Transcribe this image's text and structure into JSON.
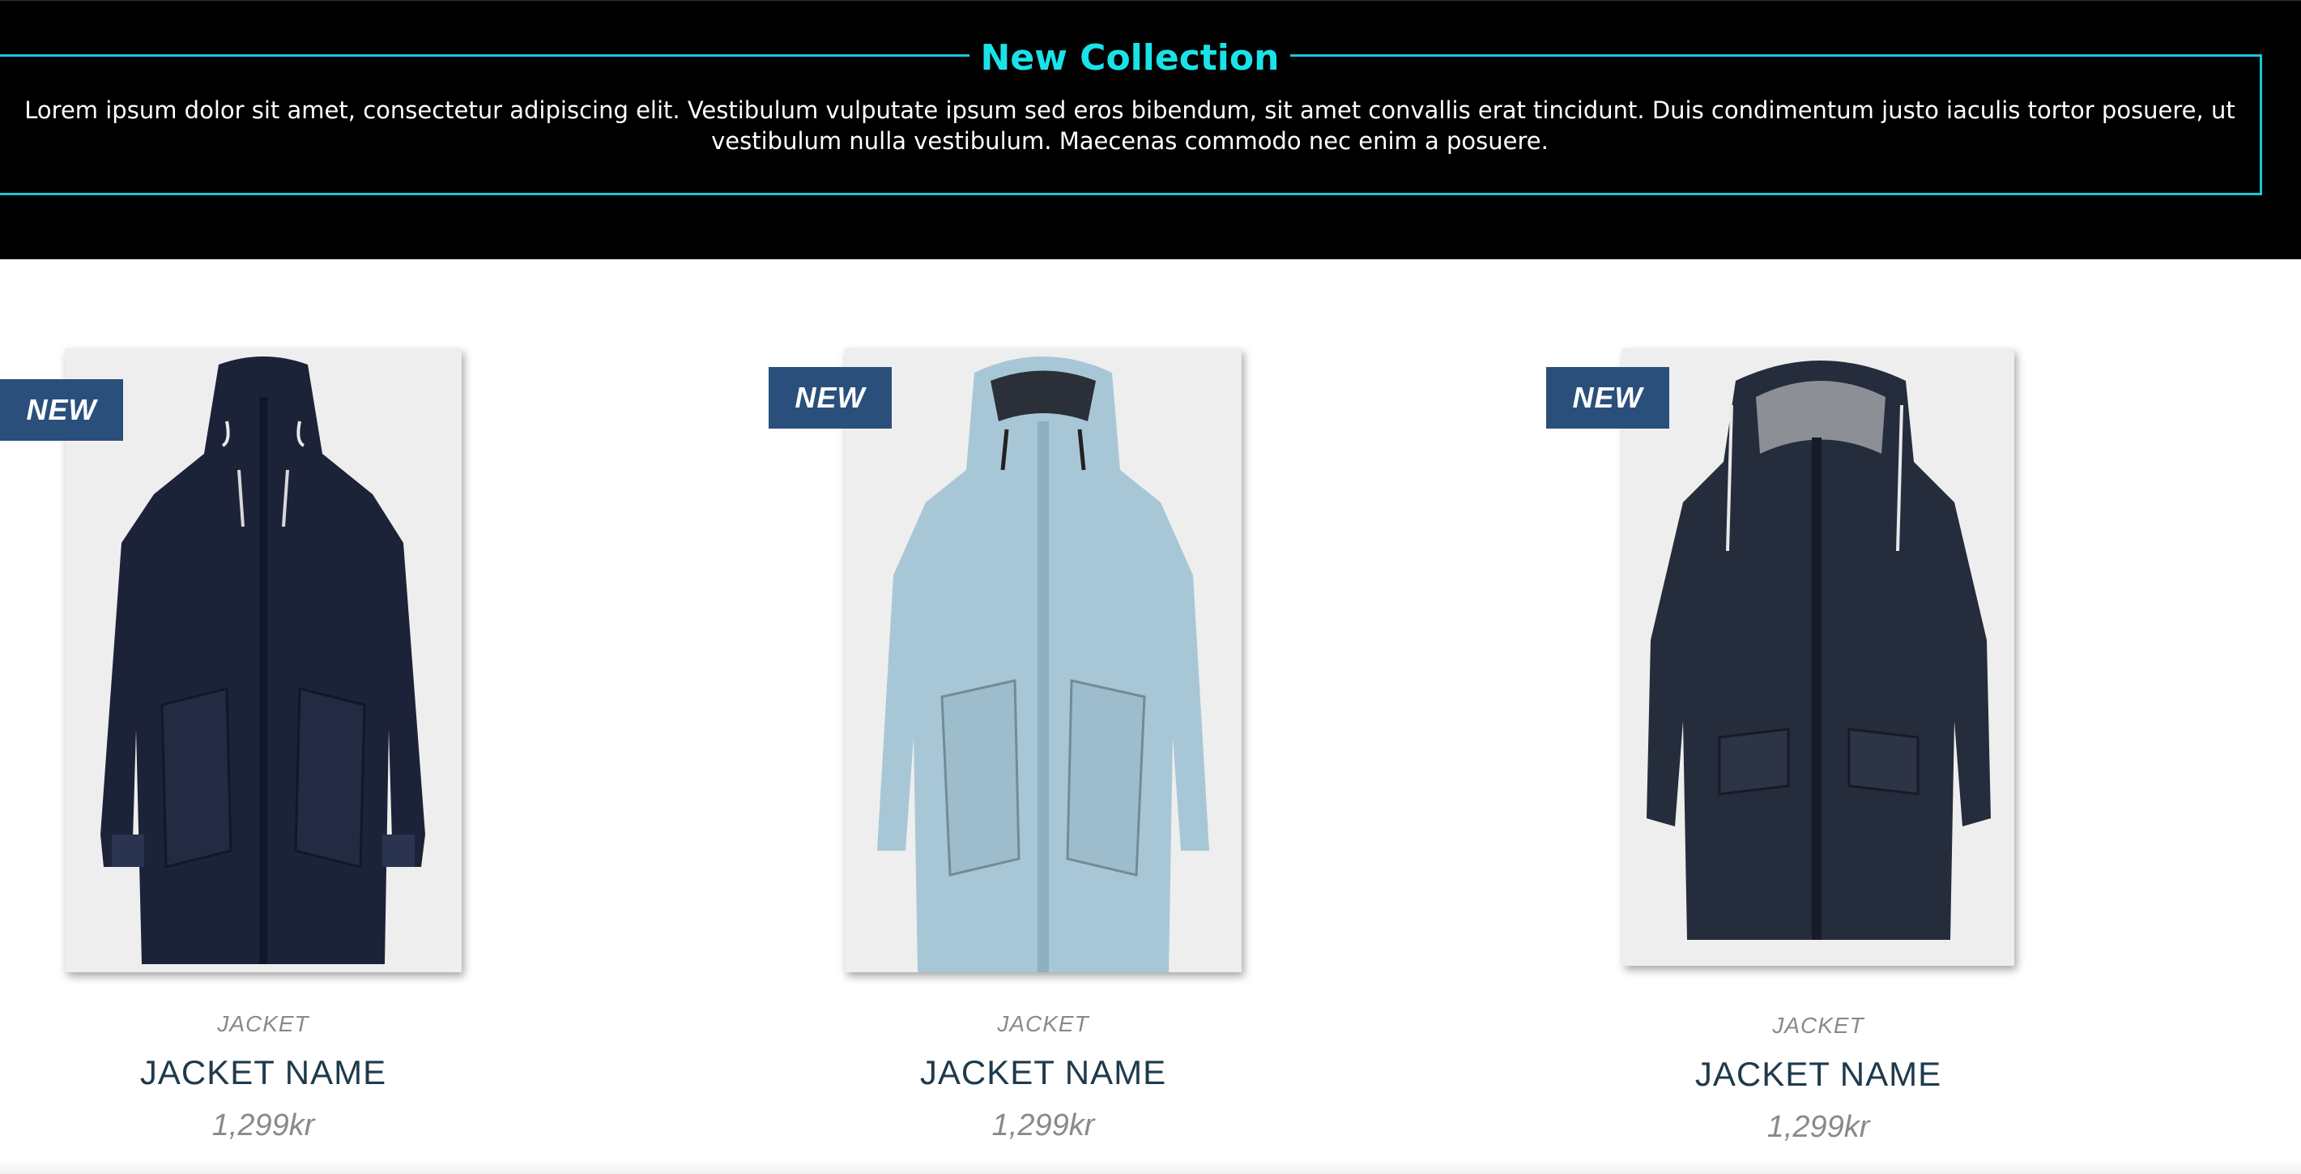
{
  "hero": {
    "title": "New Collection",
    "text": "Lorem ipsum dolor sit amet, consectetur adipiscing elit. Vestibulum vulputate ipsum sed eros bibendum, sit amet convallis erat tincidunt. Duis condimentum justo iaculis tortor posuere, ut vestibulum nulla vestibulum. Maecenas commodo nec enim a posuere.",
    "accent_color": "#19e3e8",
    "background": "#000000"
  },
  "products": [
    {
      "badge": "NEW",
      "category": "JACKET",
      "name": "JACKET NAME",
      "price": "1,299kr",
      "color": "#1c2338"
    },
    {
      "badge": "NEW",
      "category": "JACKET",
      "name": "JACKET NAME",
      "price": "1,299kr",
      "color": "#a8c7d6"
    },
    {
      "badge": "NEW",
      "category": "JACKET",
      "name": "JACKET NAME",
      "price": "1,299kr",
      "color": "#252c3b"
    }
  ],
  "badge_color": "#2a4f7b"
}
